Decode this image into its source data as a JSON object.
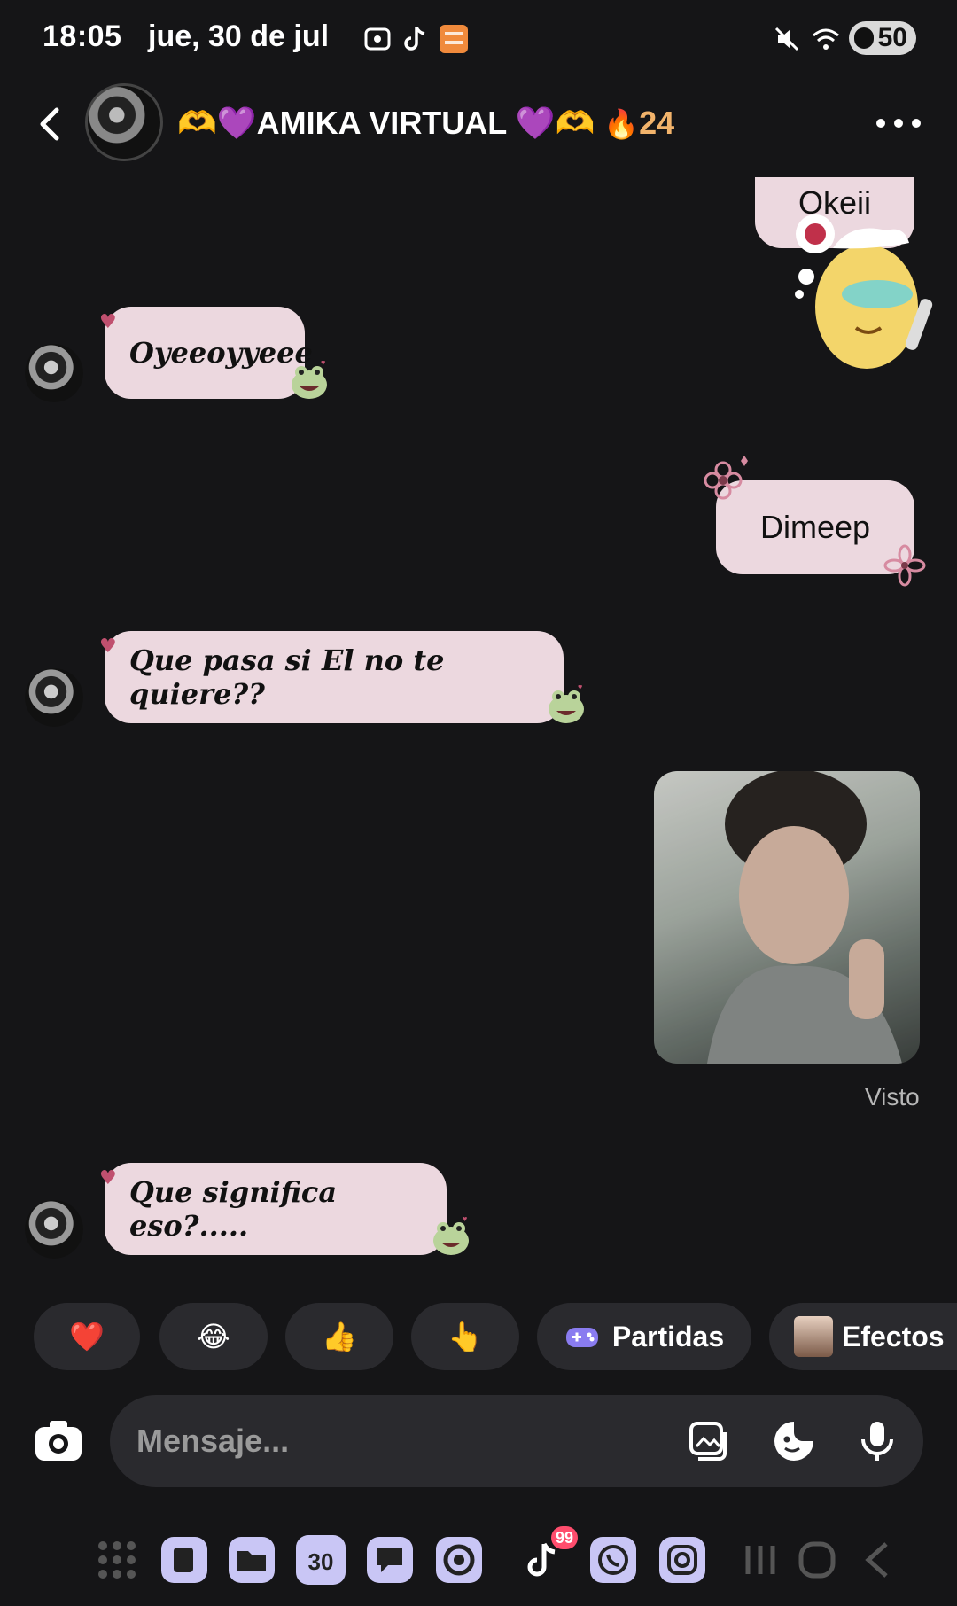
{
  "status_bar": {
    "time": "18:05",
    "date": "jue, 30 de jul",
    "battery": "50"
  },
  "header": {
    "title": "🫶💜AMIKA VIRTUAL 💜🫶",
    "streak": "24"
  },
  "messages": [
    {
      "side": "out",
      "text": "Okeii"
    },
    {
      "side": "in",
      "text": "Oyeeoyyeee"
    },
    {
      "side": "out",
      "text": "Dimeep"
    },
    {
      "side": "in",
      "text": "Que pasa  si El no te quiere??"
    },
    {
      "side": "out",
      "type": "photo"
    },
    {
      "side": "in",
      "text": "Que significa eso?....."
    }
  ],
  "seen_label": "Visto",
  "quick_replies": {
    "heart": "❤️",
    "laugh": "😂",
    "thumbs": "👍",
    "point": "👆",
    "games": "Partidas",
    "effects": "Efectos"
  },
  "composer": {
    "placeholder": "Mensaje..."
  },
  "dock": {
    "calendar_day": "30",
    "tiktok_badge": "99"
  },
  "colors": {
    "background": "#151517",
    "bubble": "#ecd8df",
    "chip": "#2a2a2e",
    "accent_heart": "#c0506f"
  }
}
